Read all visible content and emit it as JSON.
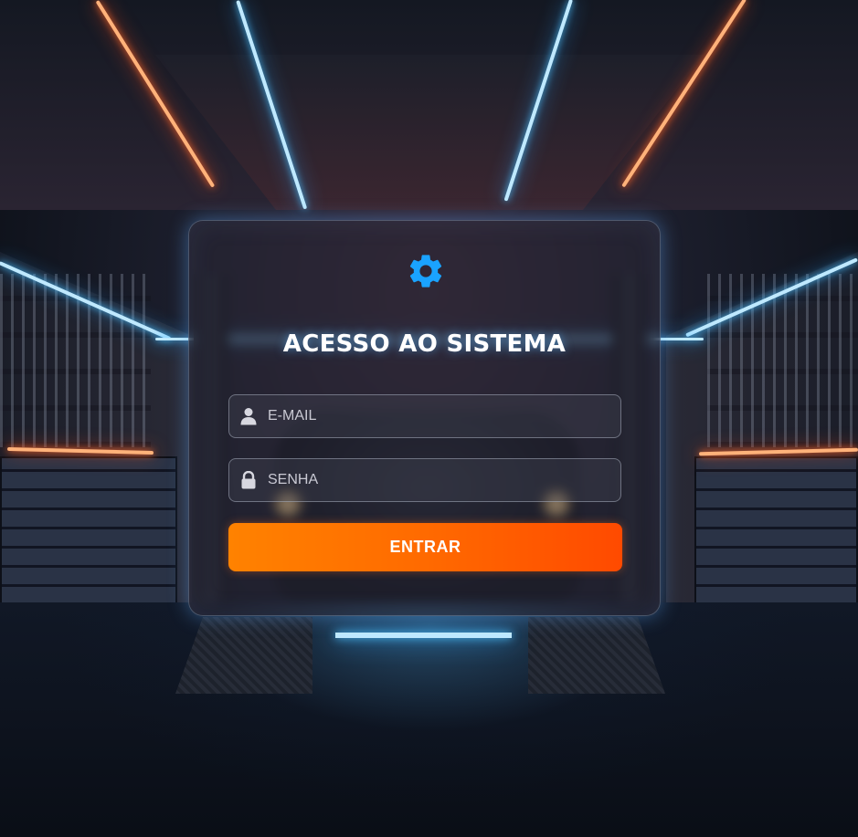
{
  "login": {
    "title": "ACESSO AO SISTEMA",
    "email_placeholder": "E-MAIL",
    "password_placeholder": "SENHA",
    "submit_label": "ENTRAR"
  },
  "icons": {
    "logo": "gear-icon",
    "email": "user-icon",
    "password": "lock-icon"
  },
  "colors": {
    "accent_icon": "#1aa3ff",
    "button_start": "#ff8200",
    "button_end": "#ff4a00",
    "title_text": "#ffffff"
  }
}
